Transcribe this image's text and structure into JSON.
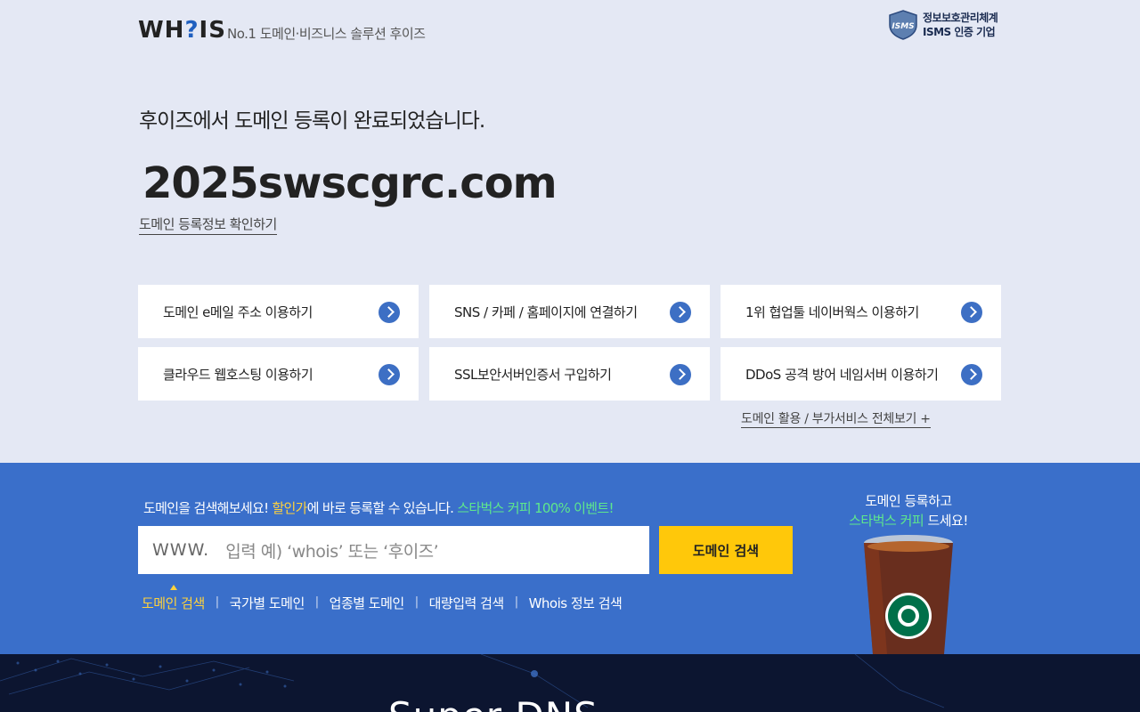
{
  "header": {
    "logo": "WHOIS",
    "tagline": "No.1 도메인·비즈니스 솔루션 후이즈",
    "isms_line1": "정보보호관리체계",
    "isms_line2": "ISMS 인증 기업"
  },
  "main": {
    "complete_message": "후이즈에서 도메인 등록이 완료되었습니다.",
    "domain": "2025swscgrc.com",
    "registration_link": "도메인 등록정보 확인하기"
  },
  "services": [
    {
      "label": "도메인 e메일 주소 이용하기"
    },
    {
      "label": "SNS / 카페 / 홈페이지에 연결하기"
    },
    {
      "label": "1위 협업툴 네이버웍스 이용하기"
    },
    {
      "label": "클라우드 웹호스팅 이용하기"
    },
    {
      "label": "SSL보안서버인증서 구입하기"
    },
    {
      "label": "DDoS 공격 방어 네임서버 이용하기"
    }
  ],
  "more_link": "도메인 활용 / 부가서비스 전체보기 +",
  "search": {
    "promo_prefix": "도메인을 검색해보세요! ",
    "promo_highlight": "할인가",
    "promo_middle": "에 바로 등록할 수 있습니다. ",
    "promo_event": "스타벅스 커피 100% 이벤트!",
    "www_prefix": "WWW.",
    "placeholder": "입력 예) ‘whois’ 또는 ‘후이즈’",
    "button": "도메인 검색",
    "tabs": [
      "도메인 검색",
      "국가별 도메인",
      "업종별 도메인",
      "대량입력 검색",
      "Whois 정보 검색"
    ],
    "tab_separator": "|"
  },
  "promo_side": {
    "line1": "도메인 등록하고",
    "line2_green": "스타벅스 커피",
    "line2_rest": " 드세요!"
  },
  "footer": {
    "title": "Super DNS"
  },
  "colors": {
    "accent_blue": "#3a6fca",
    "button_yellow": "#ffc80a",
    "highlight_yellow": "#ffd23c",
    "highlight_green": "#5ee88c",
    "footer_navy": "#0c1530"
  }
}
